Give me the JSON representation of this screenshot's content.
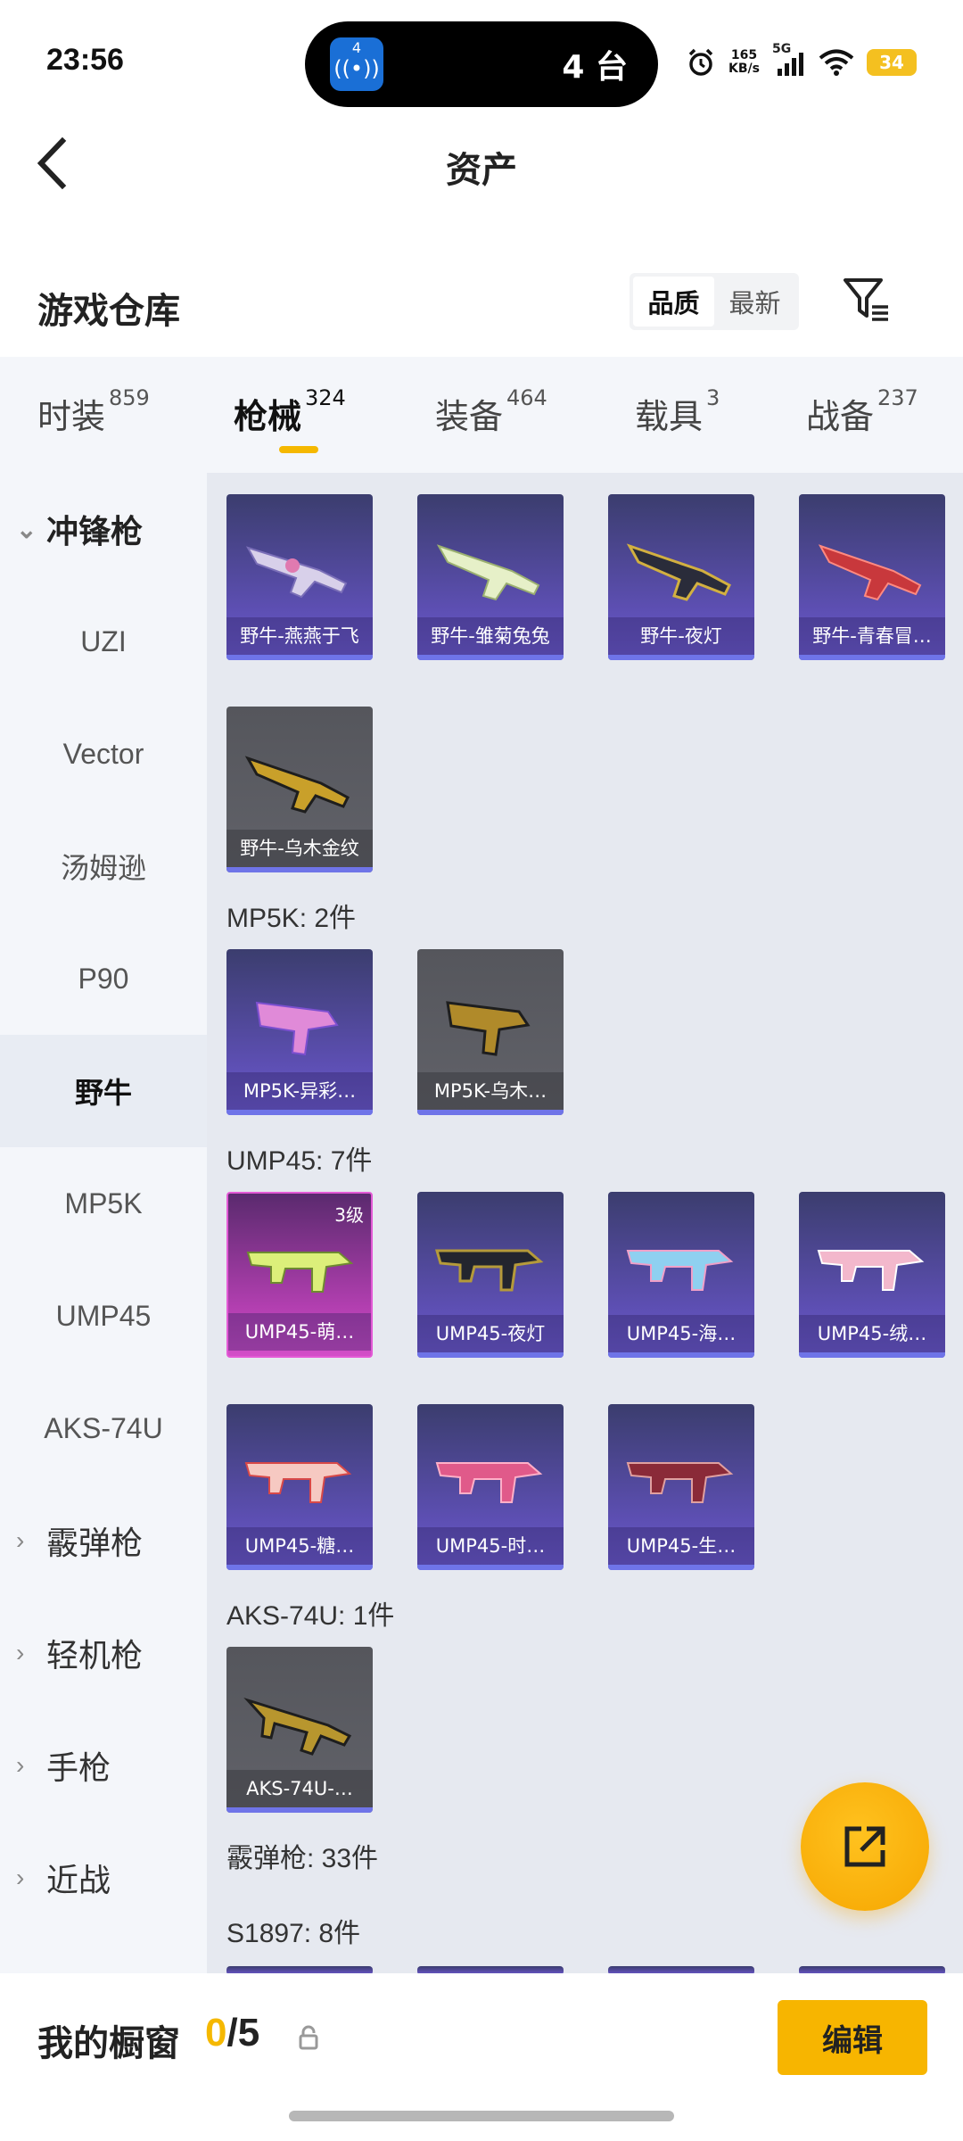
{
  "status_bar": {
    "time": "23:56",
    "island_app_badge": "4",
    "island_count": "4 台",
    "net_speed_value": "165",
    "net_speed_unit": "KB/s",
    "network_type": "5G",
    "battery": "34"
  },
  "header": {
    "title": "资产"
  },
  "section": {
    "title": "游戏仓库",
    "sort_options": [
      "品质",
      "最新"
    ]
  },
  "tabs": [
    {
      "label": "时装",
      "count": "859"
    },
    {
      "label": "枪械",
      "count": "324"
    },
    {
      "label": "装备",
      "count": "464"
    },
    {
      "label": "载具",
      "count": "3"
    },
    {
      "label": "战备",
      "count": "237"
    }
  ],
  "sidebar": {
    "items": [
      {
        "label": "冲锋枪"
      },
      {
        "label": "UZI"
      },
      {
        "label": "Vector"
      },
      {
        "label": "汤姆逊"
      },
      {
        "label": "P90"
      },
      {
        "label": "野牛"
      },
      {
        "label": "MP5K"
      },
      {
        "label": "UMP45"
      },
      {
        "label": "AKS-74U"
      },
      {
        "label": "霰弹枪"
      },
      {
        "label": "轻机枪"
      },
      {
        "label": "手枪"
      },
      {
        "label": "近战"
      }
    ]
  },
  "content": {
    "groups": [
      {
        "label": ""
      },
      {
        "label": "MP5K: 2件"
      },
      {
        "label": "UMP45: 7件"
      },
      {
        "label": "AKS-74U: 1件"
      },
      {
        "label": "霰弹枪: 33件"
      },
      {
        "label": "S1897: 8件"
      }
    ],
    "items": [
      {
        "name": "野牛-燕燕于飞"
      },
      {
        "name": "野牛-雏菊兔兔"
      },
      {
        "name": "野牛-夜灯"
      },
      {
        "name": "野牛-青春冒…"
      },
      {
        "name": "野牛-乌木金纹"
      },
      {
        "name": "MP5K-异彩…"
      },
      {
        "name": "MP5K-乌木…"
      },
      {
        "name": "UMP45-萌…",
        "level": "3级"
      },
      {
        "name": "UMP45-夜灯"
      },
      {
        "name": "UMP45-海…"
      },
      {
        "name": "UMP45-绒…"
      },
      {
        "name": "UMP45-糖…"
      },
      {
        "name": "UMP45-时…"
      },
      {
        "name": "UMP45-生…"
      },
      {
        "name": "AKS-74U-…"
      }
    ]
  },
  "bottom_bar": {
    "showcase_label": "我的橱窗",
    "showcase_current": "0",
    "showcase_total": "/5",
    "edit_label": "编辑"
  },
  "colors": {
    "accent": "#f5b800",
    "card_purple": "#5d4fb3",
    "card_gray": "#5e5f66",
    "card_pink": "#d34ec8"
  }
}
